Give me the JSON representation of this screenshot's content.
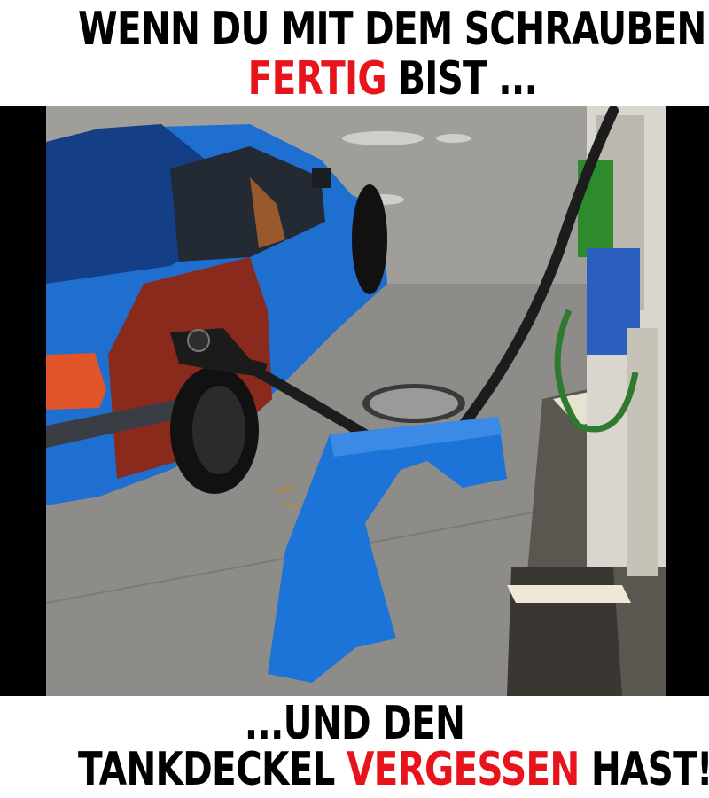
{
  "caption": {
    "line1": "WENN DU MIT DEM SCHRAUBEN",
    "line2_highlight": "FERTIG",
    "line2_rest": " BIST ...",
    "line3": "...UND DEN",
    "line4_start": "TANKDECKEL ",
    "line4_highlight": "VERGESSEN",
    "line4_end": " HAST!"
  },
  "colors": {
    "highlight": "#e8141b",
    "text": "#000000",
    "car_blue": "#1e6fd0",
    "car_red": "#8a2a1c"
  }
}
